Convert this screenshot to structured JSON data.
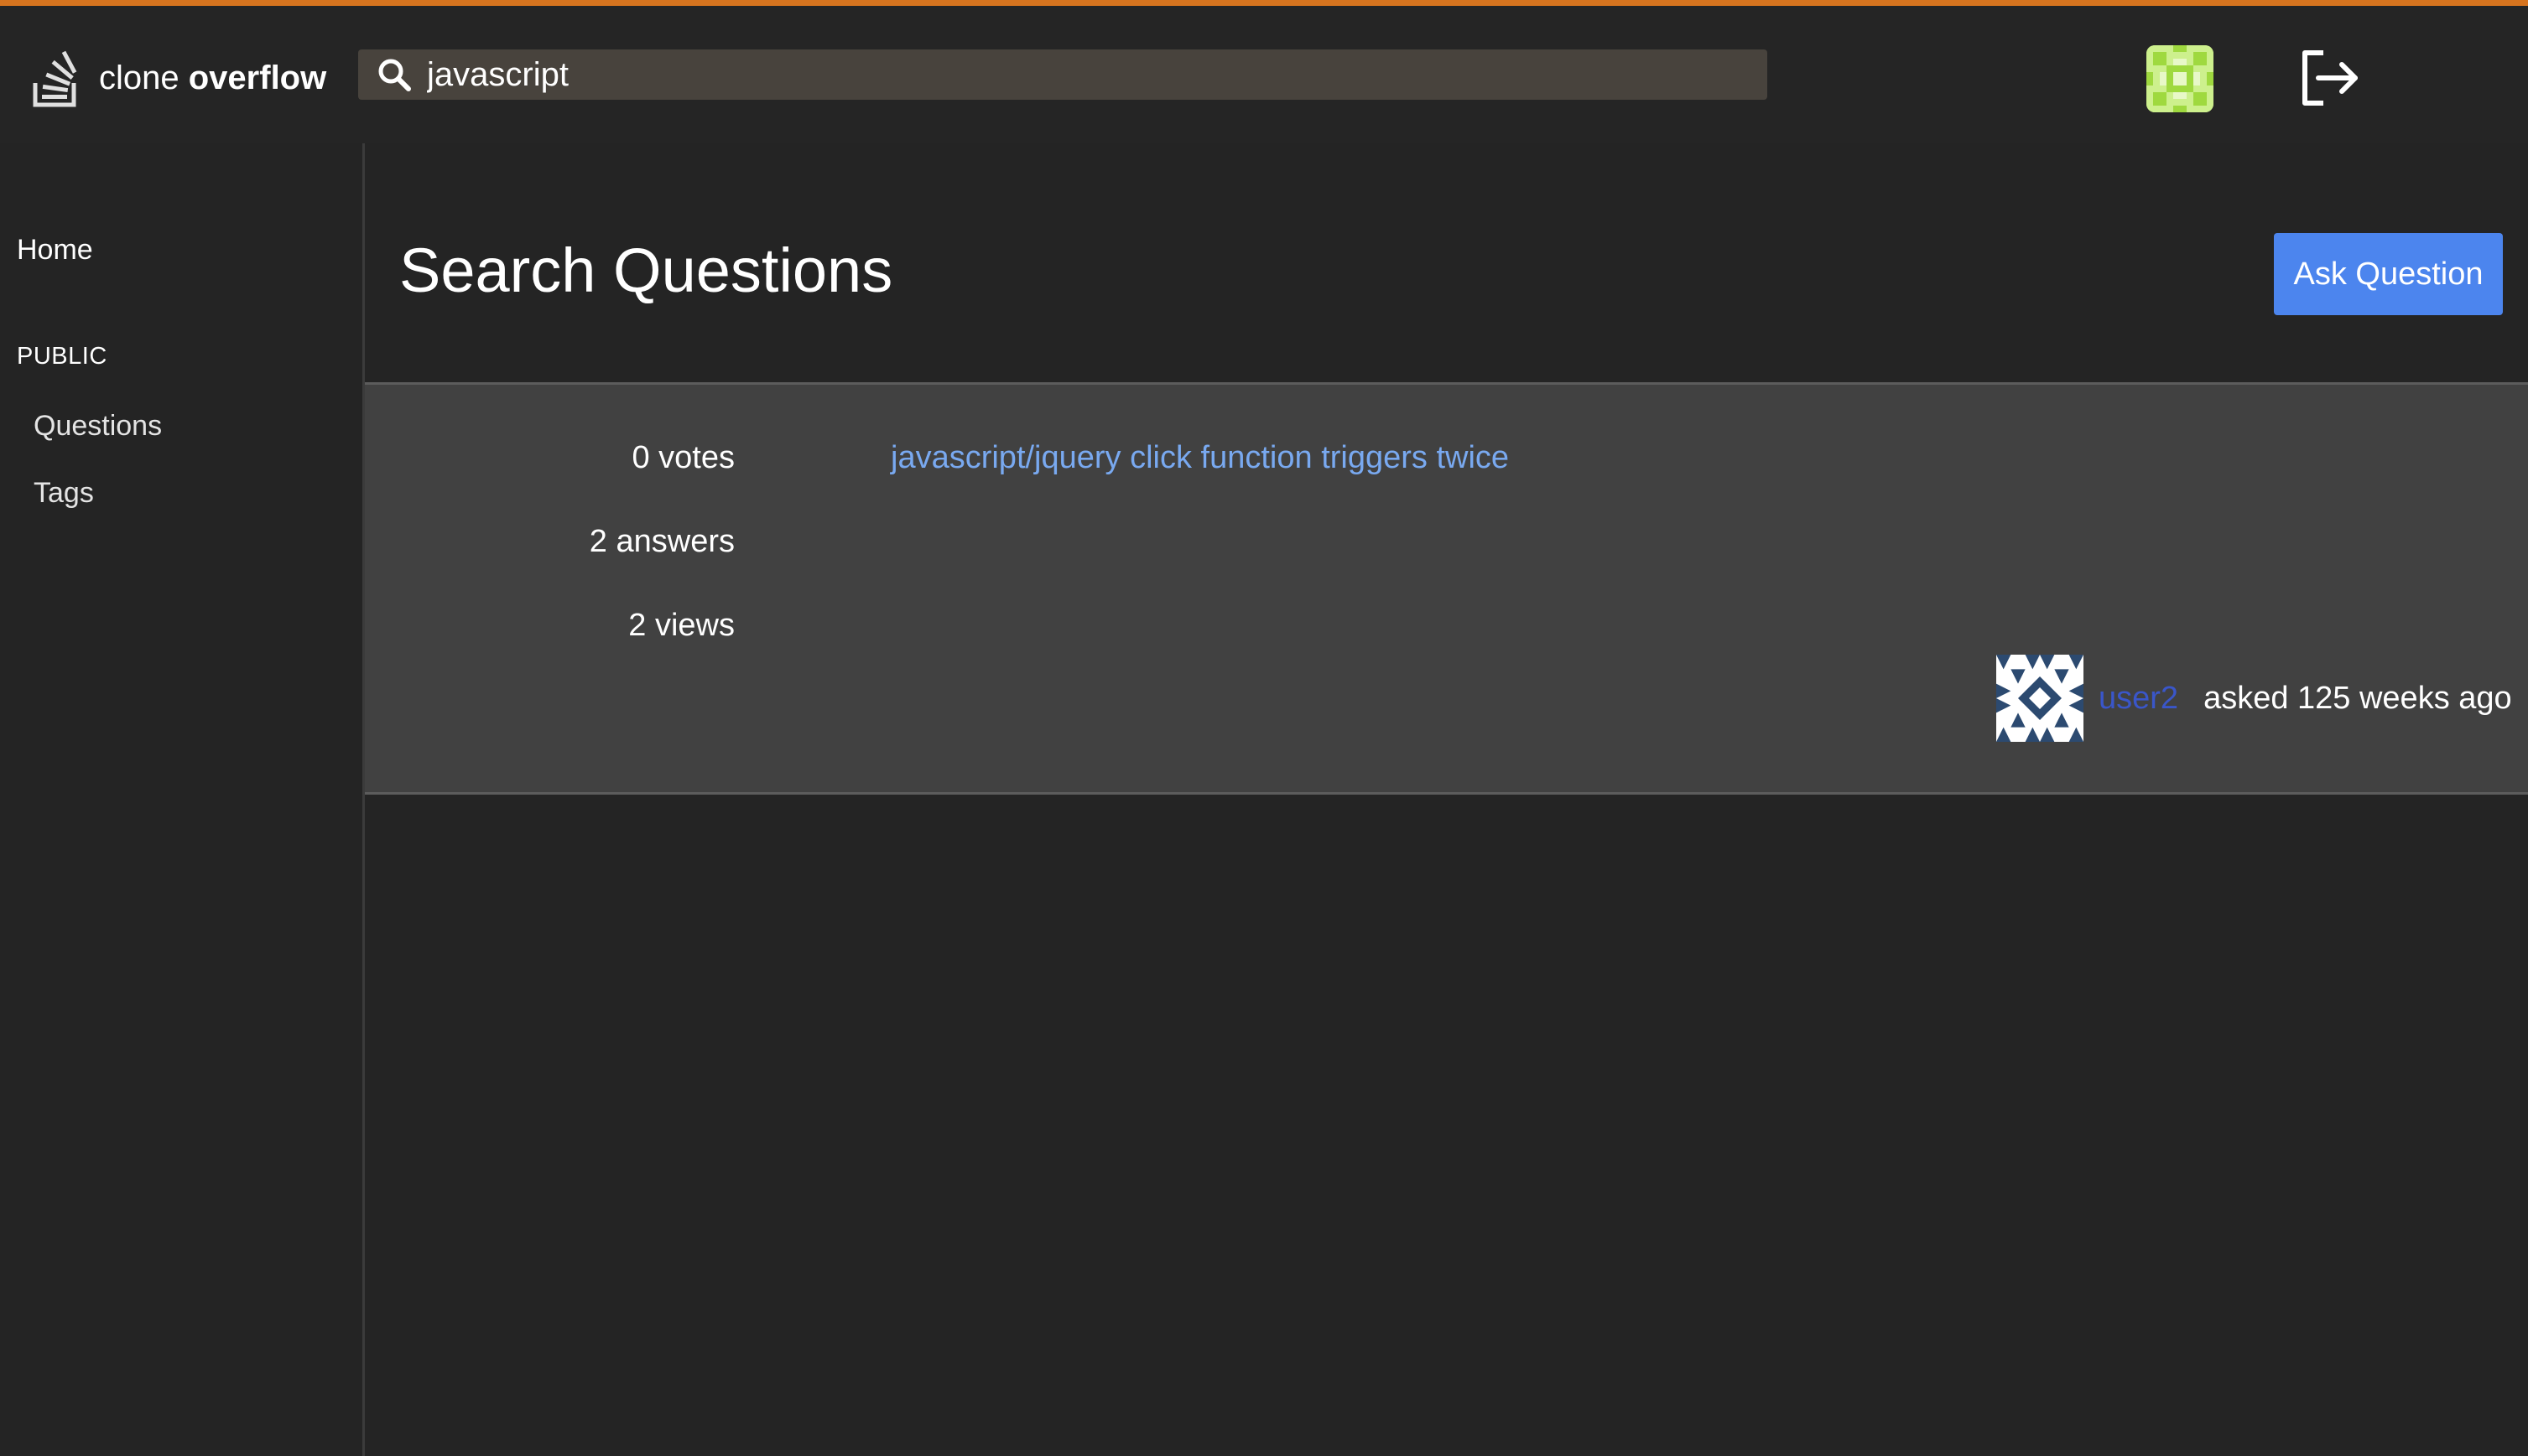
{
  "app": {
    "name_light": "clone",
    "name_bold": "overflow"
  },
  "search": {
    "value": "javascript"
  },
  "sidebar": {
    "home": "Home",
    "section": "PUBLIC",
    "items": [
      "Questions",
      "Tags"
    ]
  },
  "page": {
    "title": "Search Questions",
    "ask_button": "Ask Question"
  },
  "questions": [
    {
      "votes": "0 votes",
      "answers": "2 answers",
      "views": "2 views",
      "title": "javascript/jquery click function triggers twice",
      "user": "user2",
      "asked": "asked 125 weeks ago"
    }
  ],
  "colors": {
    "accent": "#d6741f",
    "link": "#79a9f0",
    "button": "#4c85ee",
    "user_link": "#3a56c9",
    "background": "#242424",
    "row": "#414141"
  },
  "icons": [
    "stack-logo-icon",
    "search-icon",
    "user-avatar-icon",
    "logout-icon"
  ]
}
